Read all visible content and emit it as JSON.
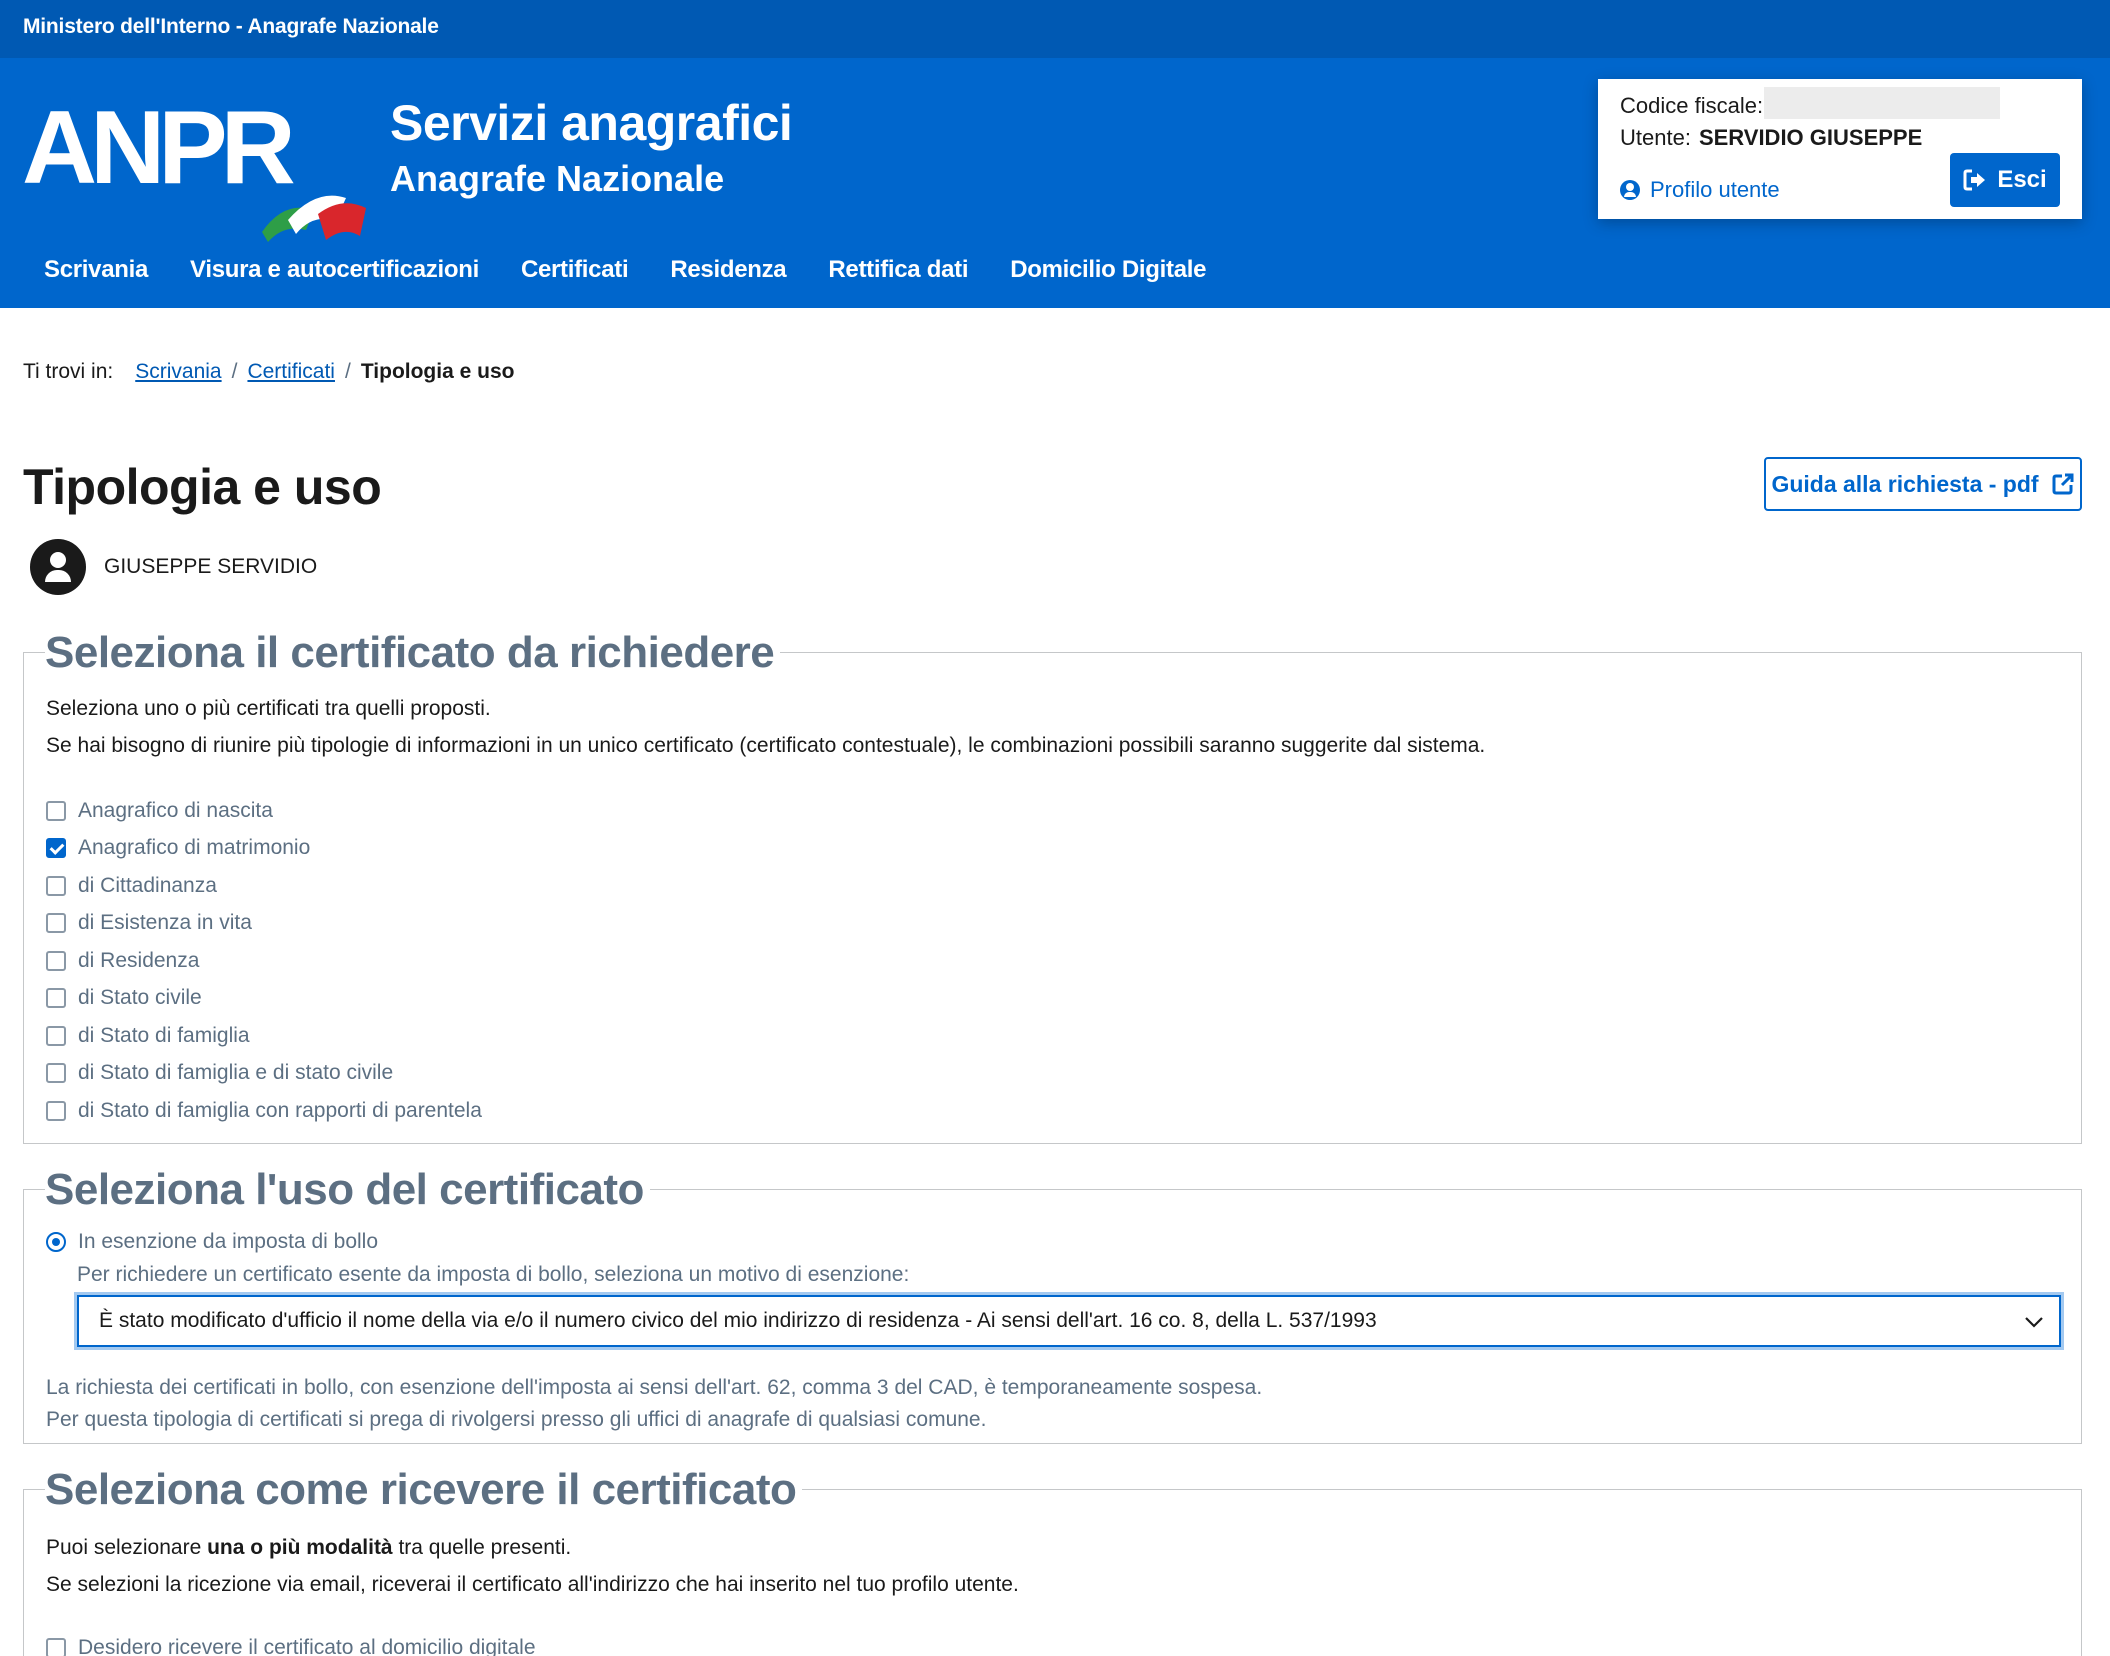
{
  "slim_header": {
    "text": "Ministero dell'Interno - Anagrafe Nazionale"
  },
  "header": {
    "logo_text": "ANPR",
    "title": "Servizi anagrafici",
    "subtitle": "Anagrafe Nazionale"
  },
  "user_box": {
    "cf_label": "Codice fiscale:",
    "user_label": "Utente:",
    "user_name": "SERVIDIO GIUSEPPE",
    "profile_label": "Profilo utente",
    "logout_label": "Esci"
  },
  "nav": {
    "items": [
      {
        "label": "Scrivania"
      },
      {
        "label": "Visura e autocertificazioni"
      },
      {
        "label": "Certificati"
      },
      {
        "label": "Residenza"
      },
      {
        "label": "Rettifica dati"
      },
      {
        "label": "Domicilio Digitale"
      }
    ]
  },
  "breadcrumb": {
    "prefix": "Ti trovi in:",
    "items": [
      "Scrivania",
      "Certificati"
    ],
    "current": "Tipologia e uso"
  },
  "page": {
    "title": "Tipologia e uso",
    "guide_button": "Guida alla richiesta - pdf",
    "person_name": "GIUSEPPE SERVIDIO"
  },
  "section_certificate": {
    "legend": "Seleziona il certificato da richiedere",
    "intro_1": "Seleziona uno o più certificati tra quelli proposti.",
    "intro_2": "Se hai bisogno di riunire più tipologie di informazioni in un unico certificato (certificato contestuale), le combinazioni possibili saranno suggerite dal sistema.",
    "options": [
      {
        "label": "Anagrafico di nascita",
        "checked": false
      },
      {
        "label": "Anagrafico di matrimonio",
        "checked": true
      },
      {
        "label": "di Cittadinanza",
        "checked": false
      },
      {
        "label": "di Esistenza in vita",
        "checked": false
      },
      {
        "label": "di Residenza",
        "checked": false
      },
      {
        "label": "di Stato civile",
        "checked": false
      },
      {
        "label": "di Stato di famiglia",
        "checked": false
      },
      {
        "label": "di Stato di famiglia e di stato civile",
        "checked": false
      },
      {
        "label": "di Stato di famiglia con rapporti di parentela",
        "checked": false
      }
    ]
  },
  "section_use": {
    "legend": "Seleziona l'uso del certificato",
    "radio_label": "In esenzione da imposta di bollo",
    "hint": "Per richiedere un certificato esente da imposta di bollo, seleziona un motivo di esenzione:",
    "selected_reason": "È stato modificato d'ufficio il nome della via e/o il numero civico del mio indirizzo di residenza - Ai sensi dell'art. 16 co. 8, della L. 537/1993",
    "note_1": "La richiesta dei certificati in bollo, con esenzione dell'imposta ai sensi dell'art. 62, comma 3 del CAD, è temporaneamente sospesa.",
    "note_2": "Per questa tipologia di certificati si prega di rivolgersi presso gli uffici di anagrafe di qualsiasi comune."
  },
  "section_delivery": {
    "legend": "Seleziona come ricevere il certificato",
    "intro_1_pre": "Puoi selezionare ",
    "intro_1_bold": "una o più modalità",
    "intro_1_post": " tra quelle presenti.",
    "intro_2": "Se selezioni la ricezione via email, riceverai il certificato all'indirizzo che hai inserito nel tuo profilo utente.",
    "option_1": "Desidero ricevere il certificato al domicilio digitale"
  },
  "colors": {
    "primary": "#0066cc",
    "slim": "#0059b3",
    "legend": "#5c6f82"
  }
}
